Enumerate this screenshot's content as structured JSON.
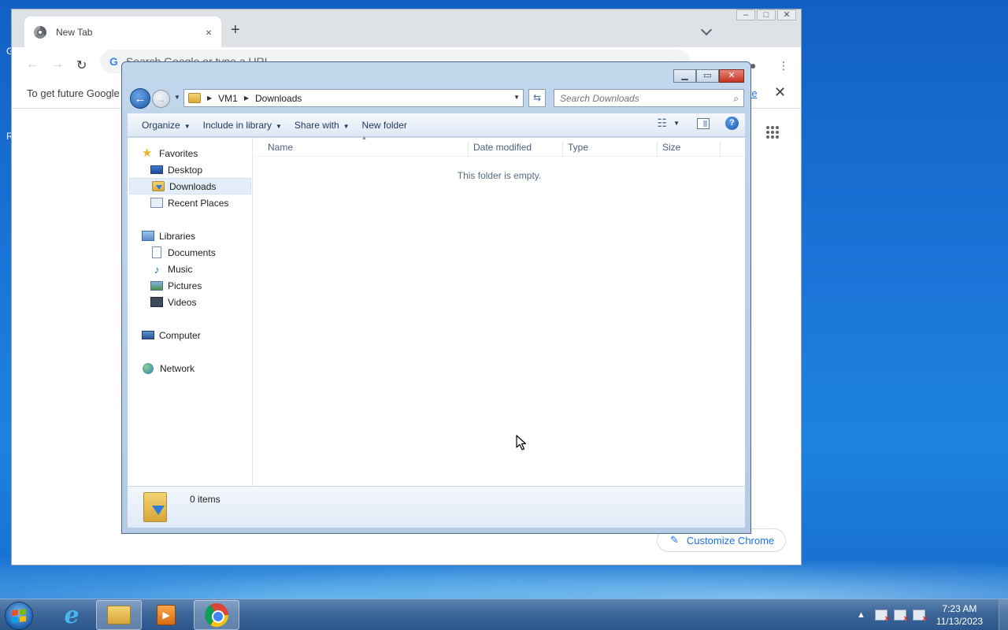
{
  "desktop": {
    "edge_text_top": "G",
    "edge_text_mid": "R"
  },
  "chrome": {
    "tab_title": "New Tab",
    "tab_close": "×",
    "new_tab": "+",
    "omnibox_g": "G",
    "omnibox_placeholder": "Search Google or type a URL",
    "infobar_text": "To get future Google",
    "infobar_link": "re",
    "infobar_close": "✕",
    "customize_label": "Customize Chrome",
    "back": "←",
    "forward": "→",
    "reload": "↻"
  },
  "explorer": {
    "breadcrumb": [
      "VM1",
      "Downloads"
    ],
    "search_placeholder": "Search Downloads",
    "commands": {
      "organize": "Organize",
      "include_in_library": "Include in library",
      "share_with": "Share with",
      "new_folder": "New folder"
    },
    "nav": {
      "favorites": "Favorites",
      "desktop": "Desktop",
      "downloads": "Downloads",
      "recent_places": "Recent Places",
      "libraries": "Libraries",
      "documents": "Documents",
      "music": "Music",
      "pictures": "Pictures",
      "videos": "Videos",
      "computer": "Computer",
      "network": "Network"
    },
    "columns": {
      "name": "Name",
      "date_modified": "Date modified",
      "type": "Type",
      "size": "Size"
    },
    "empty_message": "This folder is empty.",
    "item_count": "0 items"
  },
  "taskbar": {
    "time": "7:23 AM",
    "date": "11/13/2023",
    "tray_arrow": "▲"
  },
  "icons": {
    "favorites": "star-icon",
    "desktop": "desktop-icon",
    "downloads": "downloads-folder-icon",
    "recent": "recent-places-icon",
    "libraries": "libraries-icon",
    "documents": "document-icon",
    "music": "music-note-icon",
    "pictures": "pictures-icon",
    "videos": "videos-icon",
    "computer": "computer-icon",
    "network": "network-icon"
  },
  "colors": {
    "desktop_bg": "#1a73d6",
    "explorer_chrome": "#b5cbe4",
    "close_button": "#c43422",
    "chrome_link": "#1a73e8"
  }
}
